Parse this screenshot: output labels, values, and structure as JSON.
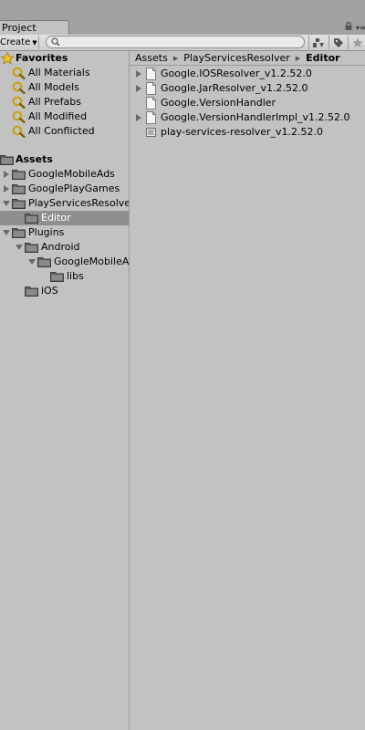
{
  "window": {
    "tab_title": "Project"
  },
  "toolbar": {
    "create_label": "Create",
    "search_value": "",
    "search_placeholder": ""
  },
  "favorites": {
    "title": "Favorites",
    "items": [
      "All Materials",
      "All Models",
      "All Prefabs",
      "All Modified",
      "All Conflicted"
    ]
  },
  "tree": {
    "root": "Assets",
    "items": [
      {
        "label": "GoogleMobileAds"
      },
      {
        "label": "GooglePlayGames"
      },
      {
        "label": "PlayServicesResolver"
      },
      {
        "label": "Editor"
      },
      {
        "label": "Plugins"
      },
      {
        "label": "Android"
      },
      {
        "label": "GoogleMobileAds"
      },
      {
        "label": "libs"
      },
      {
        "label": "iOS"
      }
    ]
  },
  "breadcrumb": [
    "Assets",
    "PlayServicesResolver",
    "Editor"
  ],
  "files": [
    "Google.IOSResolver_v1.2.52.0",
    "Google.JarResolver_v1.2.52.0",
    "Google.VersionHandler",
    "Google.VersionHandlerImpl_v1.2.52.0",
    "play-services-resolver_v1.2.52.0"
  ],
  "colors": {
    "panel": "#c2c2c2",
    "selection": "#8f8f8f",
    "folder": "#6e6e6e"
  }
}
